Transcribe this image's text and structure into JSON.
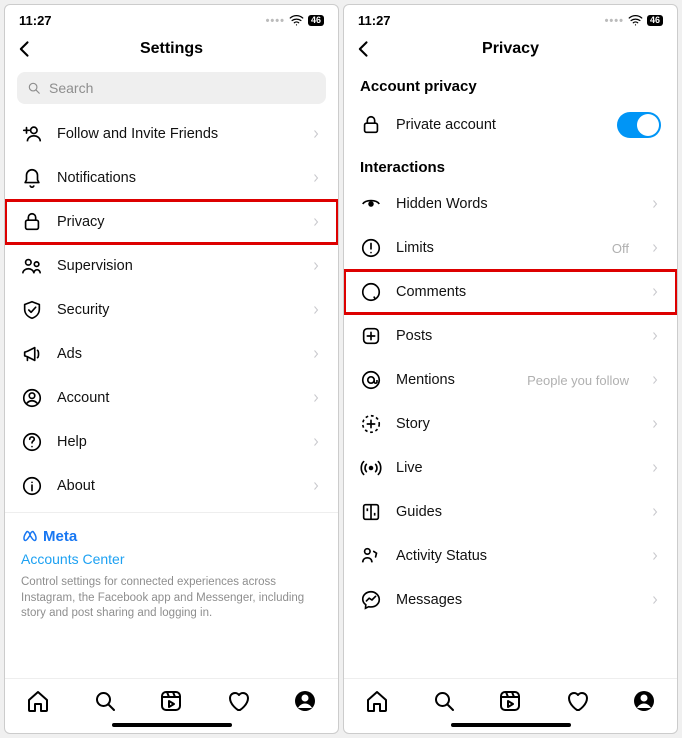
{
  "status": {
    "time": "11:27",
    "battery": "46"
  },
  "left": {
    "title": "Settings",
    "search_placeholder": "Search",
    "items": [
      {
        "label": "Follow and Invite Friends"
      },
      {
        "label": "Notifications"
      },
      {
        "label": "Privacy"
      },
      {
        "label": "Supervision"
      },
      {
        "label": "Security"
      },
      {
        "label": "Ads"
      },
      {
        "label": "Account"
      },
      {
        "label": "Help"
      },
      {
        "label": "About"
      }
    ],
    "meta_label": "Meta",
    "accounts_center": "Accounts Center",
    "footer_desc": "Control settings for connected experiences across Instagram, the Facebook app and Messenger, including story and post sharing and logging in."
  },
  "right": {
    "title": "Privacy",
    "section1": "Account privacy",
    "private_account": "Private account",
    "section2": "Interactions",
    "items": [
      {
        "label": "Hidden Words",
        "trail": ""
      },
      {
        "label": "Limits",
        "trail": "Off"
      },
      {
        "label": "Comments",
        "trail": ""
      },
      {
        "label": "Posts",
        "trail": ""
      },
      {
        "label": "Mentions",
        "trail": "People you follow"
      },
      {
        "label": "Story",
        "trail": ""
      },
      {
        "label": "Live",
        "trail": ""
      },
      {
        "label": "Guides",
        "trail": ""
      },
      {
        "label": "Activity Status",
        "trail": ""
      },
      {
        "label": "Messages",
        "trail": ""
      }
    ]
  }
}
